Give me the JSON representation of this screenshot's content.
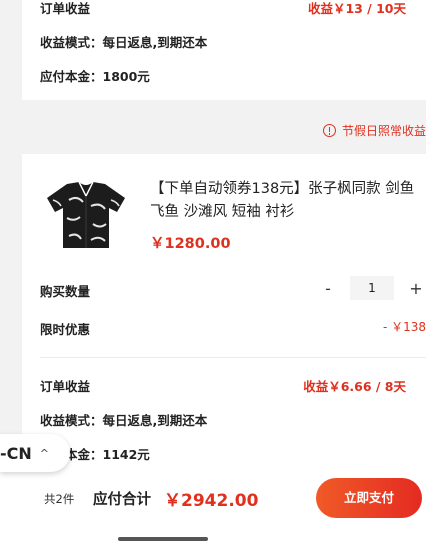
{
  "order1": {
    "income_label": "订单收益",
    "income_value": "收益￥13 / 10天",
    "mode_text": "收益模式：每日返息,到期还本",
    "principal_text": "应付本金：1800元"
  },
  "holiday_notice": "节假日照常收益",
  "product": {
    "title": "【下单自动领券138元】张子枫同款 剑鱼 飞鱼 沙滩风 短袖 衬衫",
    "price": "￥1280.00",
    "quantity_label": "购买数量",
    "quantity_value": "1",
    "minus_symbol": "-",
    "plus_symbol": "+",
    "discount_label": "限时优惠",
    "discount_value": "- ￥138"
  },
  "order2": {
    "income_label": "订单收益",
    "income_value": "收益￥6.66 / 8天",
    "mode_text": "收益模式：每日返息,到期还本",
    "principal_text": "应付本金：1142元"
  },
  "language": {
    "code": "-CN"
  },
  "footer": {
    "count_text": "共2件",
    "total_label": "应付合计",
    "total_value": "￥2942.00",
    "pay_label": "立即支付"
  },
  "colors": {
    "accent": "#e0301e",
    "pay_gradient_start": "#f05a27",
    "pay_gradient_end": "#e42b22",
    "background": "#f2f2f2"
  },
  "icons": {
    "warning": "alert-circle-icon",
    "language_chevron": "chevron-up-icon"
  }
}
